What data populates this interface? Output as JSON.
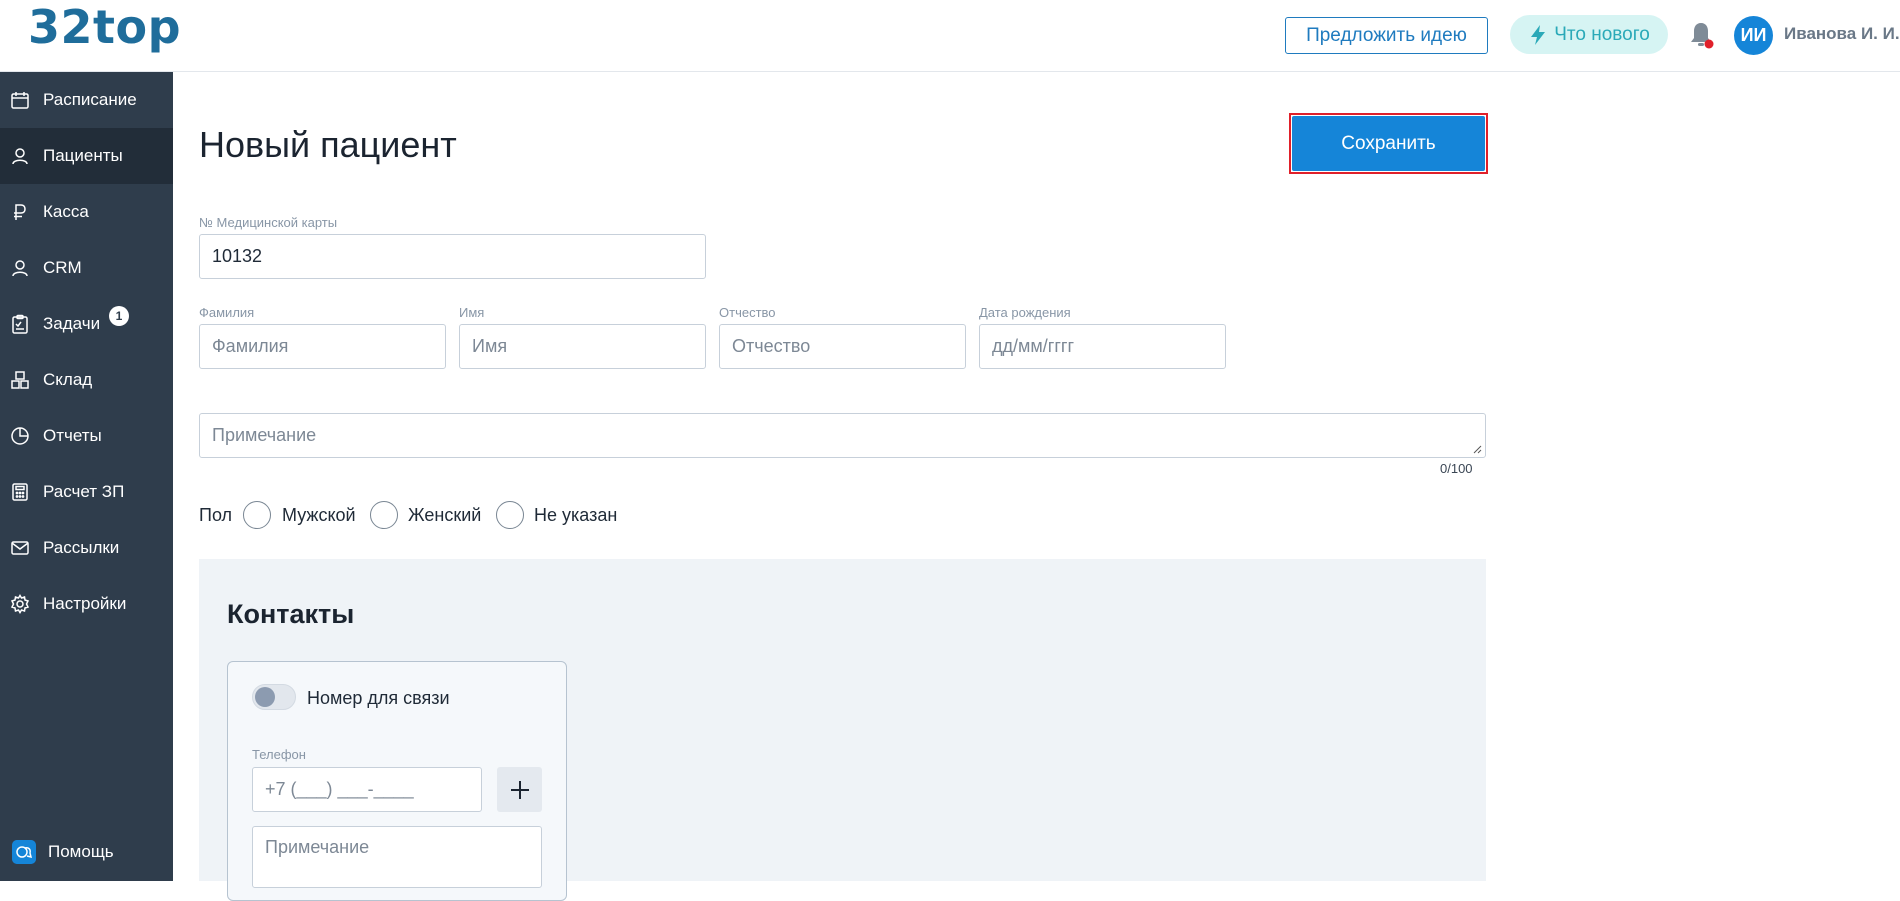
{
  "header": {
    "logo": "32top",
    "suggest_idea": "Предложить идею",
    "whats_new": "Что нового",
    "user_initials": "ИИ",
    "user_name": "Иванова И. И."
  },
  "sidebar": {
    "items": [
      {
        "label": "Расписание",
        "icon": "calendar-icon"
      },
      {
        "label": "Пациенты",
        "icon": "user-icon",
        "active": true
      },
      {
        "label": "Касса",
        "icon": "ruble-icon"
      },
      {
        "label": "CRM",
        "icon": "user-icon"
      },
      {
        "label": "Задачи",
        "icon": "clipboard-icon",
        "badge": "1"
      },
      {
        "label": "Склад",
        "icon": "boxes-icon"
      },
      {
        "label": "Отчеты",
        "icon": "pie-chart-icon"
      },
      {
        "label": "Расчет ЗП",
        "icon": "calculator-icon"
      },
      {
        "label": "Рассылки",
        "icon": "mail-icon"
      },
      {
        "label": "Настройки",
        "icon": "gear-icon"
      }
    ],
    "help": "Помощь"
  },
  "main": {
    "title": "Новый пациент",
    "save_label": "Сохранить",
    "card_number": {
      "label": "№ Медицинской карты",
      "value": "10132"
    },
    "last_name": {
      "label": "Фамилия",
      "placeholder": "Фамилия"
    },
    "first_name": {
      "label": "Имя",
      "placeholder": "Имя"
    },
    "patronymic": {
      "label": "Отчество",
      "placeholder": "Отчество"
    },
    "birth_date": {
      "label": "Дата рождения",
      "placeholder": "дд/мм/гггг"
    },
    "note": {
      "placeholder": "Примечание",
      "counter": "0/100"
    },
    "gender": {
      "label": "Пол",
      "options": [
        "Мужской",
        "Женский",
        "Не указан"
      ]
    }
  },
  "contacts": {
    "title": "Контакты",
    "toggle_label": "Номер для связи",
    "phone_label": "Телефон",
    "phone_placeholder": "+7 (___) ___-____",
    "note_placeholder": "Примечание"
  },
  "colors": {
    "accent": "#1585d8",
    "sidebar": "#2f3d4c",
    "highlight": "#e0202a"
  }
}
